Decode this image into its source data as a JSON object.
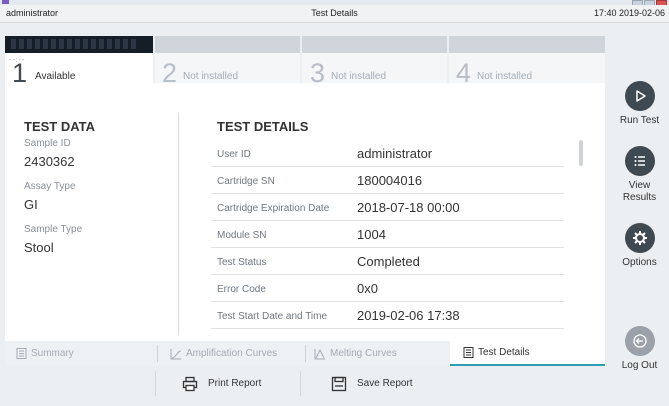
{
  "header": {
    "user": "administrator",
    "title": "Test Details",
    "datetime": "17:40 2019-02-06"
  },
  "modules": [
    {
      "number": "1",
      "label": "Available",
      "active": true
    },
    {
      "number": "2",
      "label": "Not installed",
      "active": false
    },
    {
      "number": "3",
      "label": "Not installed",
      "active": false
    },
    {
      "number": "4",
      "label": "Not installed",
      "active": false
    }
  ],
  "module_status_dots": "--:--",
  "test_data": {
    "title": "TEST DATA",
    "sample_id_label": "Sample ID",
    "sample_id": "2430362",
    "assay_type_label": "Assay Type",
    "assay_type": "GI",
    "sample_type_label": "Sample Type",
    "sample_type": "Stool"
  },
  "test_details": {
    "title": "TEST DETAILS",
    "rows": [
      {
        "key": "User ID",
        "value": "administrator"
      },
      {
        "key": "Cartridge SN",
        "value": "180004016"
      },
      {
        "key": "Cartridge Expiration Date",
        "value": "2018-07-18 00:00"
      },
      {
        "key": "Module SN",
        "value": "1004"
      },
      {
        "key": "Test Status",
        "value": "Completed"
      },
      {
        "key": "Error Code",
        "value": "0x0"
      },
      {
        "key": "Test Start Date and Time",
        "value": "2019-02-06 17:38"
      }
    ]
  },
  "view_tabs": [
    {
      "label": "Summary",
      "icon": "summary-icon",
      "active": false
    },
    {
      "label": "Amplification Curves",
      "icon": "amplification-curves-icon",
      "active": false
    },
    {
      "label": "Melting Curves",
      "icon": "melting-curves-icon",
      "active": false
    },
    {
      "label": "Test Details",
      "icon": "test-details-icon",
      "active": true
    }
  ],
  "actions": {
    "print": "Print Report",
    "save": "Save Report"
  },
  "sidebar": {
    "run_test": "Run Test",
    "view_results_1": "View",
    "view_results_2": "Results",
    "options": "Options",
    "log_out": "Log Out"
  },
  "colors": {
    "accent": "#2c9fb5",
    "sidebar_button": "#3f4952",
    "active_module_bar": "#151d27"
  }
}
